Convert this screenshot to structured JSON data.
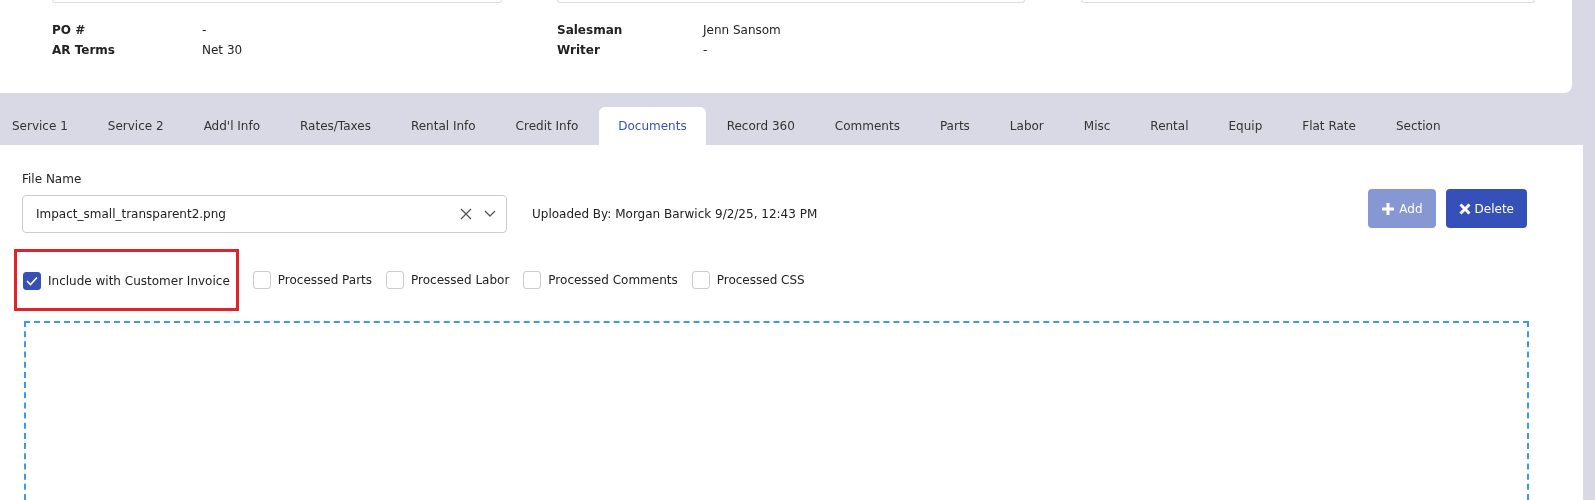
{
  "header_fields": [
    {
      "label": "PO #",
      "value": "-"
    },
    {
      "label": "AR Terms",
      "value": "Net 30"
    },
    {
      "label": "Salesman",
      "value": "Jenn Sansom"
    },
    {
      "label": "Writer",
      "value": "-"
    }
  ],
  "tabs": [
    {
      "label": "Service 1",
      "selected": false
    },
    {
      "label": "Service 2",
      "selected": false
    },
    {
      "label": "Add'l Info",
      "selected": false
    },
    {
      "label": "Rates/Taxes",
      "selected": false
    },
    {
      "label": "Rental Info",
      "selected": false
    },
    {
      "label": "Credit Info",
      "selected": false
    },
    {
      "label": "Documents",
      "selected": true
    },
    {
      "label": "Record 360",
      "selected": false
    },
    {
      "label": "Comments",
      "selected": false
    },
    {
      "label": "Parts",
      "selected": false
    },
    {
      "label": "Labor",
      "selected": false
    },
    {
      "label": "Misc",
      "selected": false
    },
    {
      "label": "Rental",
      "selected": false
    },
    {
      "label": "Equip",
      "selected": false
    },
    {
      "label": "Flat Rate",
      "selected": false
    },
    {
      "label": "Section",
      "selected": false
    }
  ],
  "file_select": {
    "label": "File Name",
    "value": "Impact_small_transparent2.png"
  },
  "uploaded_by": "Uploaded By: Morgan Barwick 9/2/25, 12:43 PM",
  "buttons": [
    {
      "label": "Add",
      "kind": "add",
      "disabled": true
    },
    {
      "label": "Delete",
      "kind": "delete",
      "disabled": false
    }
  ],
  "checkboxes": [
    {
      "label": "Include with Customer Invoice",
      "checked": true,
      "highlighted": true
    },
    {
      "label": "Processed Parts",
      "checked": false,
      "highlighted": false
    },
    {
      "label": "Processed Labor",
      "checked": false,
      "highlighted": false
    },
    {
      "label": "Processed Comments",
      "checked": false,
      "highlighted": false
    },
    {
      "label": "Processed CSS",
      "checked": false,
      "highlighted": false
    }
  ]
}
